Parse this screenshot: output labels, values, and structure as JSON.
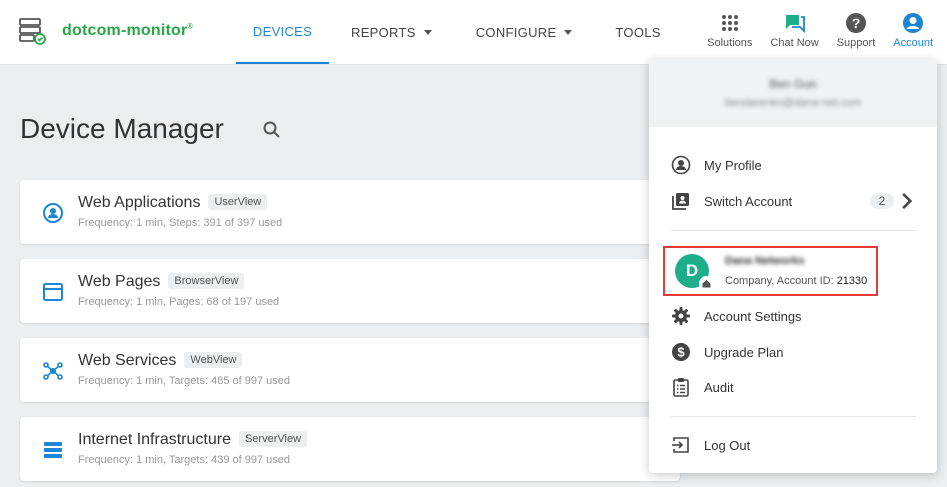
{
  "header": {
    "logo_text": "dotcom-monitor",
    "logo_mark": "®",
    "nav": [
      {
        "label": "DEVICES",
        "active": true
      },
      {
        "label": "REPORTS",
        "dropdown": true
      },
      {
        "label": "CONFIGURE",
        "dropdown": true
      },
      {
        "label": "TOOLS"
      }
    ],
    "utilities": [
      {
        "label": "Solutions",
        "icon": "grid-icon"
      },
      {
        "label": "Chat Now",
        "icon": "chat-icon"
      },
      {
        "label": "Support",
        "icon": "help-icon"
      },
      {
        "label": "Account",
        "icon": "account-icon"
      }
    ]
  },
  "main": {
    "title": "Device Manager",
    "cards": [
      {
        "title": "Web Applications",
        "tag": "UserView",
        "subtitle": "Frequency: 1 min, Steps: 391 of 397 used",
        "icon": "user-circle-icon"
      },
      {
        "title": "Web Pages",
        "tag": "BrowserView",
        "subtitle": "Frequency: 1 min, Pages: 68 of 197 used",
        "icon": "browser-window-icon"
      },
      {
        "title": "Web Services",
        "tag": "WebView",
        "subtitle": "Frequency: 1 min, Targets: 485 of 997 used",
        "icon": "network-hub-icon"
      },
      {
        "title": "Internet Infrastructure",
        "tag": "ServerView",
        "subtitle": "Frequency: 1 min, Targets: 439 of 997 used",
        "icon": "server-stack-icon"
      }
    ]
  },
  "account_menu": {
    "user_name": "Ben Gun",
    "user_email": "bendarenko@dana-net.com",
    "my_profile": "My Profile",
    "switch_account": "Switch Account",
    "switch_count": "2",
    "current_account": {
      "avatar_letter": "D",
      "name": "Dana Networks",
      "info_prefix": "Company, Account ID:",
      "account_id": "21330"
    },
    "account_settings": "Account Settings",
    "upgrade_plan": "Upgrade Plan",
    "audit": "Audit",
    "log_out": "Log Out"
  },
  "colors": {
    "accent": "#1b86d6",
    "brand_green": "#27a844",
    "avatar_teal": "#1fae8c",
    "highlight_red": "#e53935"
  }
}
